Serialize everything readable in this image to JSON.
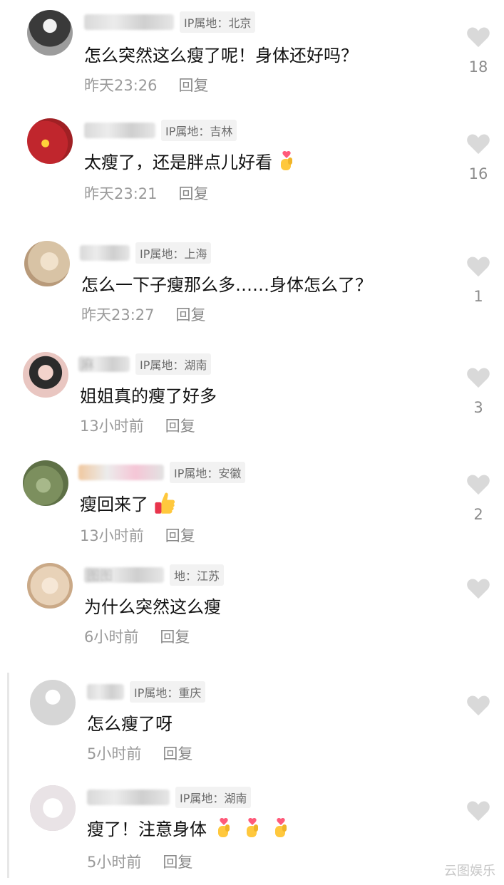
{
  "comments": [
    {
      "ip": "IP属地：北京",
      "name_hint": "",
      "text": "怎么突然这么瘦了呢！身体还好吗？",
      "time": "昨天23:26",
      "reply": "回复",
      "likes": "18",
      "emoji": []
    },
    {
      "ip": "IP属地：吉林",
      "name_hint": "",
      "text": "太瘦了，还是胖点儿好看",
      "time": "昨天23:21",
      "reply": "回复",
      "likes": "16",
      "emoji": [
        "finger-heart"
      ]
    },
    {
      "ip": "IP属地：上海",
      "name_hint": "",
      "text": "怎么一下子瘦那么多……身体怎么了？",
      "time": "昨天23:27",
      "reply": "回复",
      "likes": "1",
      "emoji": []
    },
    {
      "ip": "IP属地：湖南",
      "name_hint": "麻",
      "text": "姐姐真的瘦了好多",
      "time": "13小时前",
      "reply": "回复",
      "likes": "3",
      "emoji": []
    },
    {
      "ip": "IP属地：安徽",
      "name_hint": "",
      "text": "瘦回来了",
      "time": "13小时前",
      "reply": "回复",
      "likes": "2",
      "emoji": [
        "thumbs-up"
      ]
    },
    {
      "ip": "地：江苏",
      "name_hint": "图图",
      "text": "为什么突然这么瘦",
      "time": "6小时前",
      "reply": "回复",
      "likes": "",
      "emoji": []
    },
    {
      "ip": "IP属地：重庆",
      "name_hint": "",
      "text": "怎么瘦了呀",
      "time": "5小时前",
      "reply": "回复",
      "likes": "",
      "emoji": []
    },
    {
      "ip": "IP属地：湖南",
      "name_hint": "",
      "text": "瘦了！注意身体",
      "time": "5小时前",
      "reply": "回复",
      "likes": "",
      "emoji": [
        "finger-heart",
        "finger-heart",
        "finger-heart"
      ]
    }
  ],
  "watermark": "云图娱乐",
  "colors": {
    "avatar_1": "#5a5a5a",
    "avatar_2": "#c0262d",
    "avatar_3": "#d8c3a5",
    "avatar_4": "#e9c6c1",
    "avatar_5": "#7c8f5e",
    "avatar_6": "#e8d2b8",
    "avatar_7": "#d6d6d6",
    "avatar_8": "#e9e3e6",
    "heart": "#d9d9d9"
  }
}
